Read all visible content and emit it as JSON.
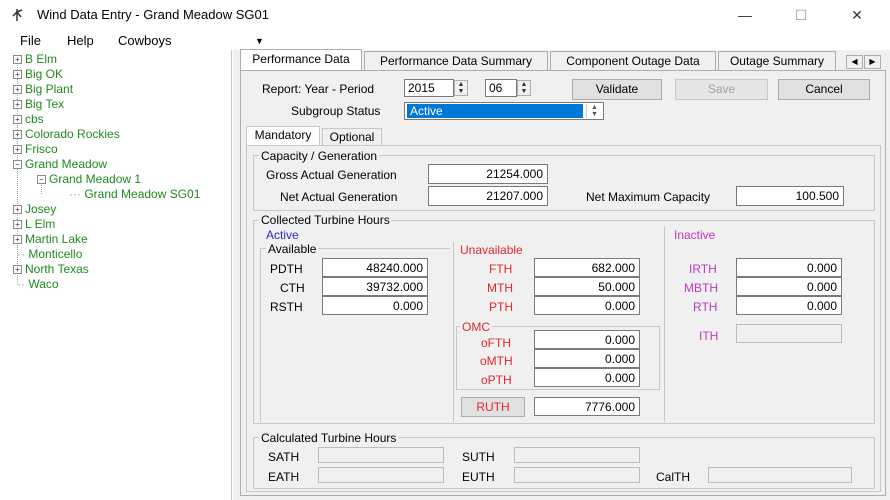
{
  "window": {
    "title": "Wind Data Entry - Grand Meadow SG01",
    "minimize": "—",
    "maximize": "☐",
    "close": "✕",
    "icon": "wind-turbine-icon"
  },
  "menu": {
    "file": "File",
    "help": "Help",
    "company": "Cowboys"
  },
  "tree": {
    "items": [
      {
        "label": "B Elm"
      },
      {
        "label": "Big OK"
      },
      {
        "label": "Big Plant"
      },
      {
        "label": "Big Tex"
      },
      {
        "label": "cbs"
      },
      {
        "label": "Colorado Rockies"
      },
      {
        "label": "Frisco"
      },
      {
        "label": "Grand Meadow"
      },
      {
        "label": "Grand Meadow 1"
      },
      {
        "label": "Grand Meadow SG01"
      },
      {
        "label": "Josey"
      },
      {
        "label": "L Elm"
      },
      {
        "label": "Martin Lake"
      },
      {
        "label": "Monticello"
      },
      {
        "label": "North Texas"
      },
      {
        "label": "Waco"
      }
    ]
  },
  "tabs": [
    {
      "label": "Performance Data"
    },
    {
      "label": "Performance Data Summary"
    },
    {
      "label": "Component Outage Data"
    },
    {
      "label": "Outage Summary"
    }
  ],
  "report": {
    "label": "Report:  Year - Period",
    "year": "2015",
    "period": "06",
    "subgroup_label": "Subgroup Status",
    "subgroup_value": "Active"
  },
  "buttons": {
    "validate": "Validate",
    "save": "Save",
    "cancel": "Cancel"
  },
  "subtabs": {
    "mandatory": "Mandatory",
    "optional": "Optional"
  },
  "capacity": {
    "title": "Capacity / Generation",
    "gross_label": "Gross Actual Generation",
    "gross_value": "21254.000",
    "net_label": "Net Actual Generation",
    "net_value": "21207.000",
    "max_label": "Net Maximum Capacity",
    "max_value": "100.500"
  },
  "collected": {
    "title": "Collected Turbine Hours",
    "active_label": "Active",
    "available_label": "Available",
    "pdth_label": "PDTH",
    "pdth_value": "48240.000",
    "cth_label": "CTH",
    "cth_value": "39732.000",
    "rsth_label": "RSTH",
    "rsth_value": "0.000",
    "unavailable_label": "Unavailable",
    "fth_label": "FTH",
    "fth_value": "682.000",
    "mth_label": "MTH",
    "mth_value": "50.000",
    "pth_label": "PTH",
    "pth_value": "0.000",
    "omc_label": "OMC",
    "ofth_label": "oFTH",
    "ofth_value": "0.000",
    "omth_label": "oMTH",
    "omth_value": "0.000",
    "opth_label": "oPTH",
    "opth_value": "0.000",
    "ruth_label": "RUTH",
    "ruth_value": "7776.000",
    "inactive_label": "Inactive",
    "irth_label": "IRTH",
    "irth_value": "0.000",
    "mbth_label": "MBTH",
    "mbth_value": "0.000",
    "rth_label": "RTH",
    "rth_value": "0.000",
    "ith_label": "ITH",
    "ith_value": ""
  },
  "calculated": {
    "title": "Calculated Turbine Hours",
    "sath_label": "SATH",
    "suth_label": "SUTH",
    "eath_label": "EATH",
    "euth_label": "EUTH",
    "calth_label": "CalTH"
  },
  "colors": {
    "tree_text": "#1f8a1f",
    "unavailable_red": "#e0282e",
    "inactive_magenta": "#c238c2",
    "active_blue": "#2b2bc0",
    "selection_blue": "#0078d7"
  }
}
